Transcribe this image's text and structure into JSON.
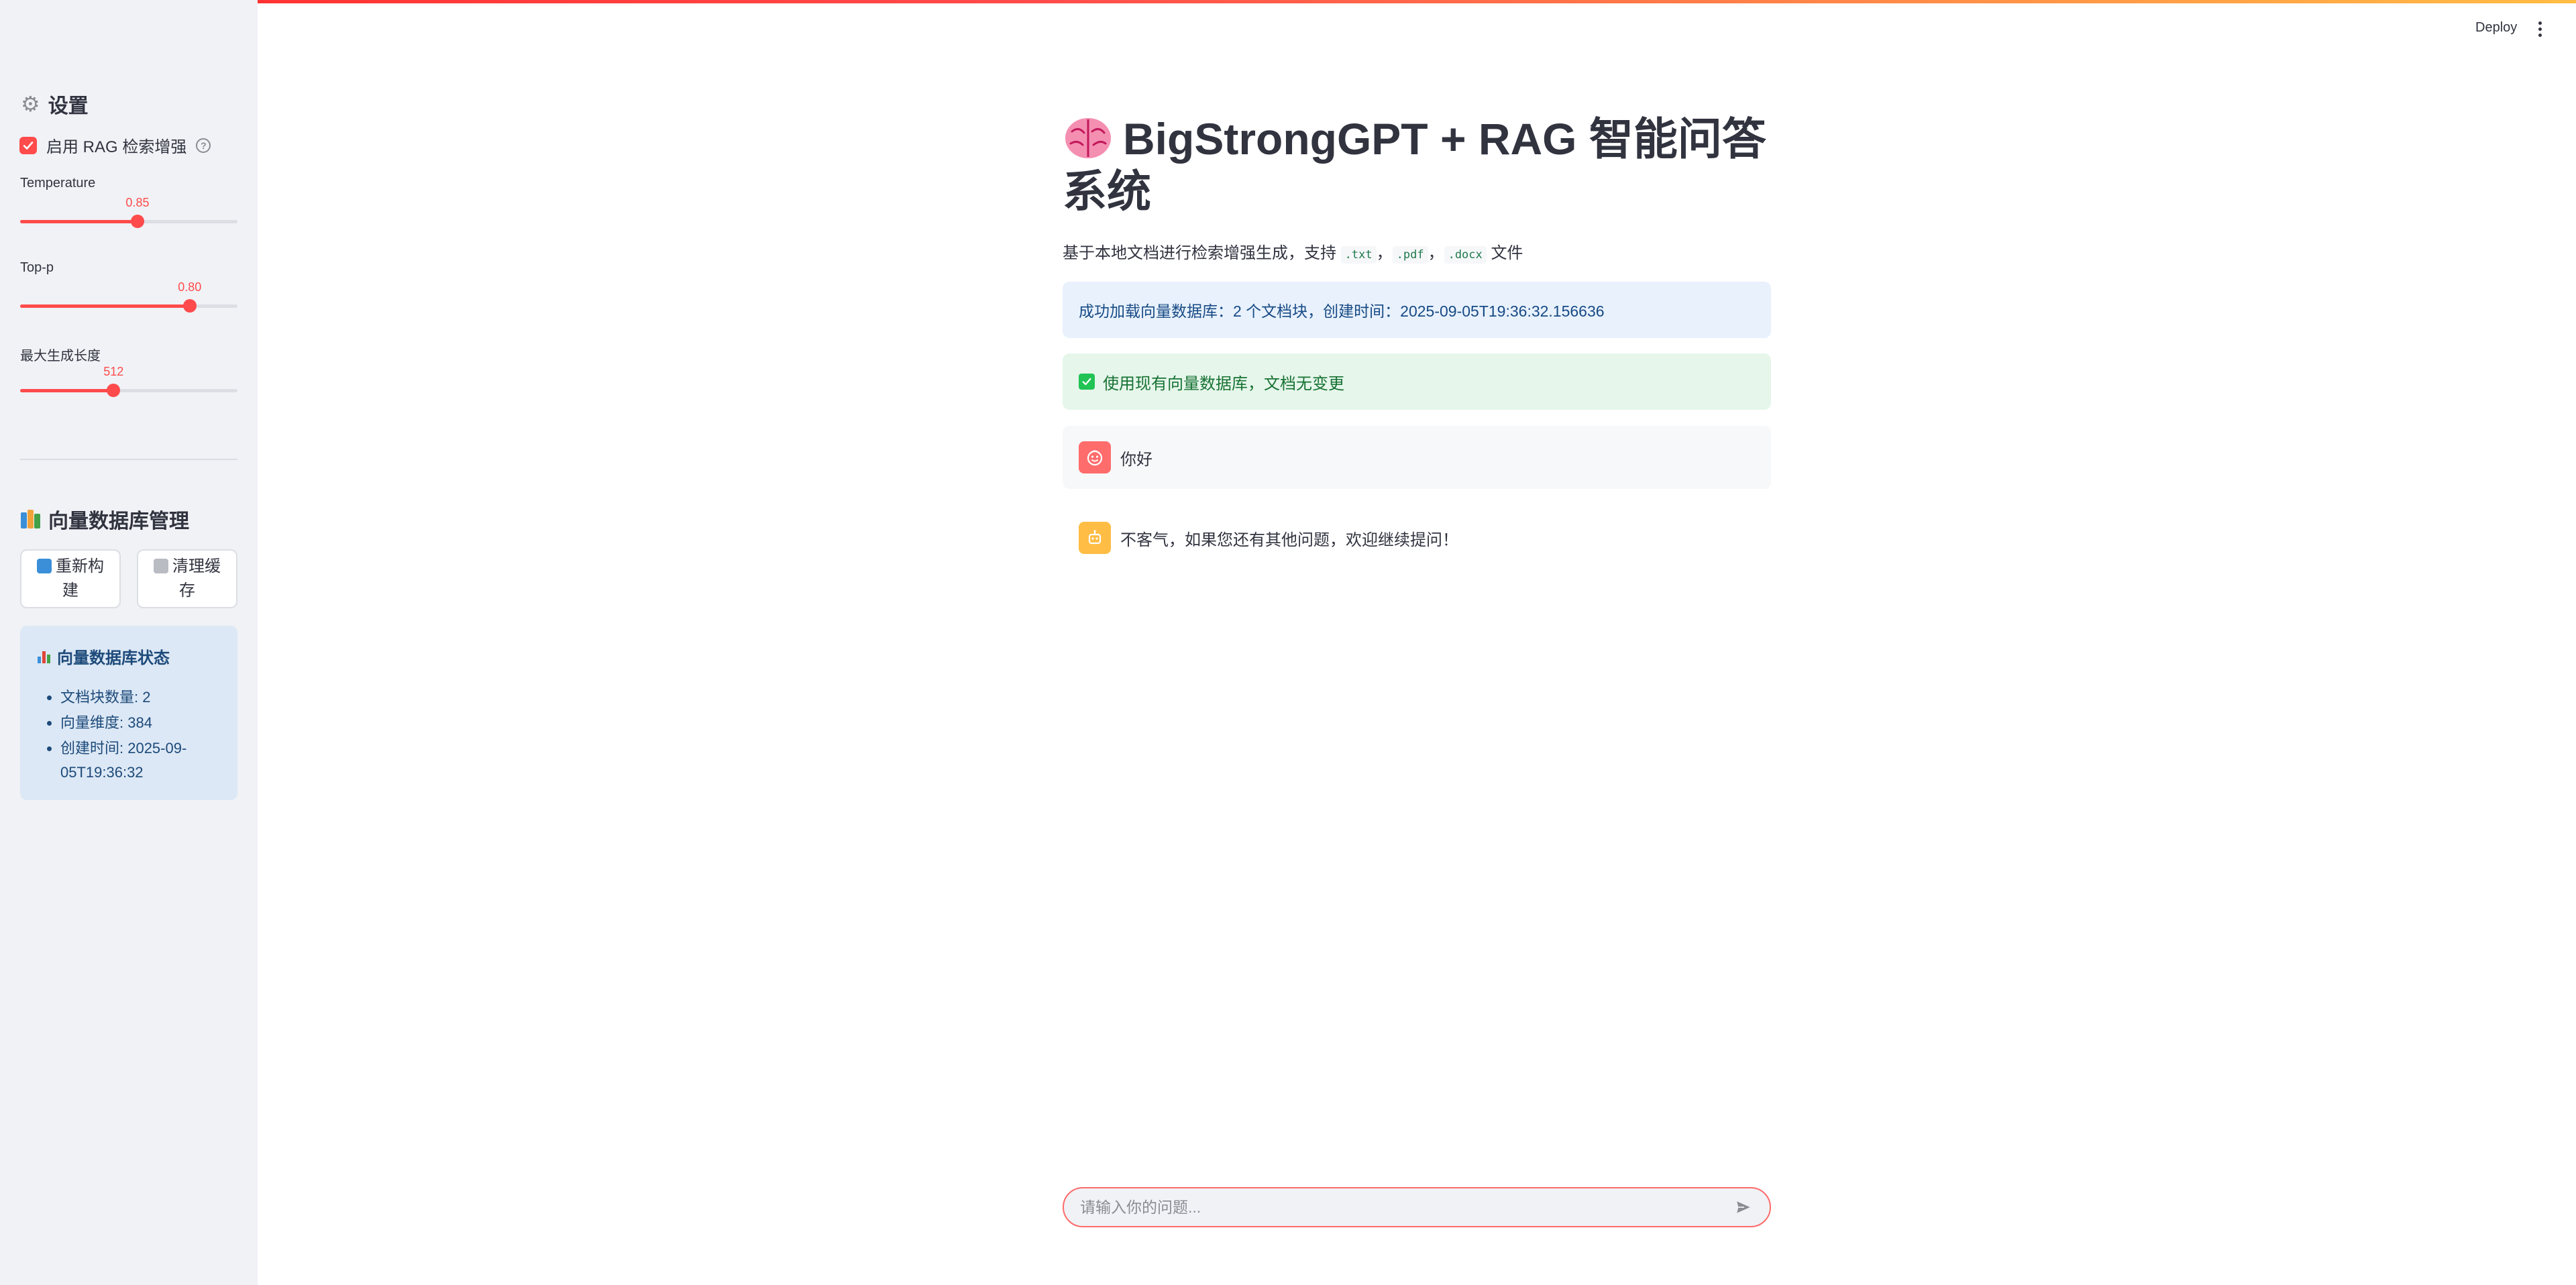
{
  "header": {
    "deploy_label": "Deploy",
    "menu_icon": "kebab-menu-icon"
  },
  "sidebar": {
    "settings_title": "设置",
    "settings_icon": "gear-icon",
    "rag_checkbox": {
      "label": "启用 RAG 检索增强",
      "checked": true,
      "help_icon": "question-circle-icon"
    },
    "sliders": [
      {
        "label": "Temperature",
        "value": "0.85",
        "fraction": 0.54
      },
      {
        "label": "Top-p",
        "value": "0.80",
        "fraction": 0.78
      },
      {
        "label": "最大生成长度",
        "value": "512",
        "fraction": 0.43
      }
    ],
    "db_title": "向量数据库管理",
    "db_icon": "books-icon",
    "rebuild_label": "重新构建",
    "rebuild_icon": "refresh-icon",
    "clear_label": "清理缓存",
    "clear_icon": "trash-icon",
    "status": {
      "title": "向量数据库状态",
      "icon": "bar-chart-icon",
      "items": [
        "文档块数量: 2",
        "向量维度: 384",
        "创建时间: 2025-09-05T19:36:32"
      ]
    }
  },
  "main": {
    "title_icon": "brain-icon",
    "title": "BigStrongGPT + RAG 智能问答系统",
    "subtitle_prefix": "基于本地文档进行检索增强生成，支持",
    "subtitle_formats": [
      ".txt",
      ".pdf",
      ".docx"
    ],
    "subtitle_sep": "，",
    "subtitle_suffix": "文件",
    "info_message": "成功加载向量数据库：2 个文档块，创建时间：2025-09-05T19:36:32.156636",
    "success_message": "使用现有向量数据库，文档无变更",
    "messages": [
      {
        "role": "user",
        "avatar_icon": "user-face-icon",
        "text": "你好"
      },
      {
        "role": "assistant",
        "avatar_icon": "robot-icon",
        "text": "不客气，如果您还有其他问题，欢迎继续提问！"
      }
    ],
    "chat_input_placeholder": "请输入你的问题...",
    "send_icon": "send-icon"
  },
  "colors": {
    "accent": "#ff4b4b",
    "sidebar_bg": "#f0f2f6",
    "info_bg": "#e8f1fc",
    "success_bg": "#e6f6eb",
    "status_bg": "#dce8f5"
  }
}
